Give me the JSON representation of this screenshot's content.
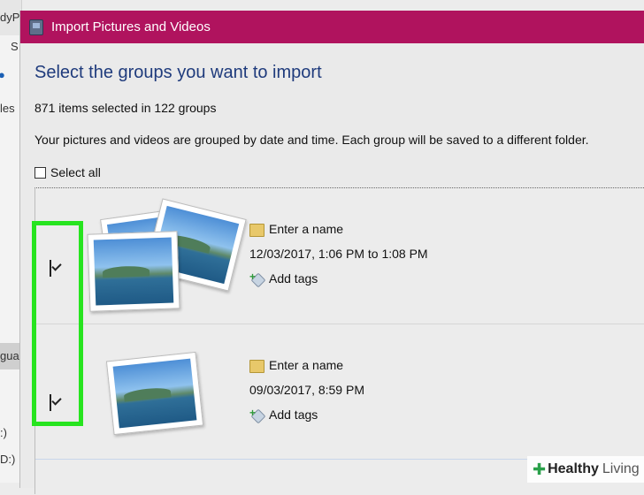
{
  "background_window": {
    "fragments": [
      "dyPl",
      "S",
      "les",
      "gua",
      ":)",
      "D:)"
    ]
  },
  "dialog": {
    "title": "Import Pictures and Videos",
    "heading": "Select the groups you want to import",
    "count_text": "871 items selected in 122 groups",
    "description": "Your pictures and videos are grouped by date and time. Each group will be saved to a different folder.",
    "select_all_label": "Select all",
    "select_all_checked": false
  },
  "groups": [
    {
      "checked": true,
      "name_placeholder": "Enter a name",
      "date_range": "12/03/2017, 1:06 PM to 1:08 PM",
      "tags_label": "Add tags"
    },
    {
      "checked": true,
      "name_placeholder": "Enter a name",
      "date_range": "09/03/2017, 8:59 PM",
      "tags_label": "Add tags"
    }
  ],
  "colors": {
    "titlebar": "#b0135e",
    "heading": "#1f3b7c",
    "highlight": "#27e41f"
  },
  "watermark": {
    "brand_a": "Healthy",
    "brand_b": "Living"
  }
}
